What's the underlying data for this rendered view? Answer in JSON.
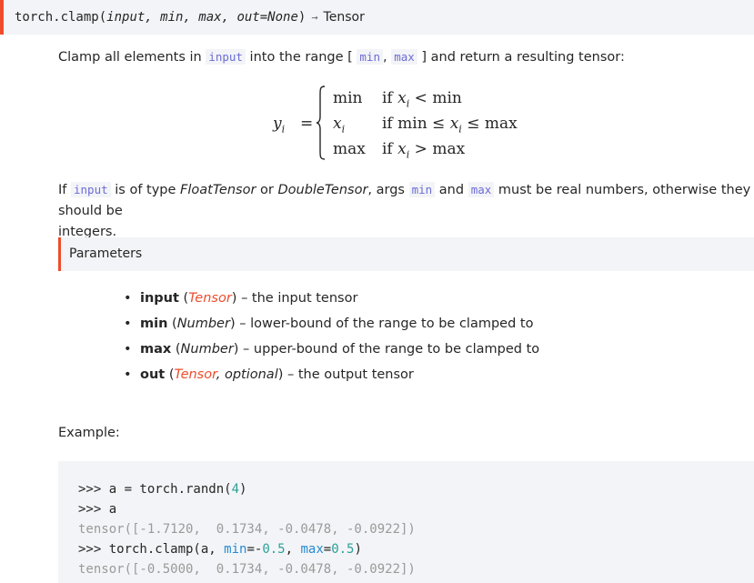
{
  "signature": {
    "func": "torch.clamp",
    "paren_open": "(",
    "args": "input, min, max, out=None",
    "paren_close": ")",
    "arrow": "→",
    "return_type": "Tensor"
  },
  "description": {
    "t1": "Clamp all elements in ",
    "c1": "input",
    "t2": " into the range [ ",
    "c2": "min",
    "t3": ", ",
    "c3": "max",
    "t4": " ] and return a resulting tensor:"
  },
  "formula": {
    "lhs": "y",
    "lhs_sub": "i",
    "eq": "=",
    "rows": [
      {
        "value": "min",
        "cond_pre": "if ",
        "cond_var": "x",
        "cond_sub": "i",
        "cond_op": " < ",
        "cond_post": "min"
      },
      {
        "value_var": "x",
        "value_sub": "i",
        "cond_pre": "if min ≤ ",
        "cond_var": "x",
        "cond_sub": "i",
        "cond_op": " ≤ ",
        "cond_post": "max"
      },
      {
        "value": "max",
        "cond_pre": "if ",
        "cond_var": "x",
        "cond_sub": "i",
        "cond_op": " > ",
        "cond_post": "max"
      }
    ]
  },
  "note": {
    "t1": "If ",
    "c1": "input",
    "t2": " is of type ",
    "i1": "FloatTensor",
    "t3": " or ",
    "i2": "DoubleTensor",
    "t4": ", args ",
    "c2": "min",
    "t5": " and ",
    "c3": "max",
    "t6": " must be real numbers, otherwise they should be",
    "line2": "integers."
  },
  "parameters": {
    "heading": "Parameters",
    "items": [
      {
        "bullet": "•",
        "name": "input",
        "open": " (",
        "type": "Tensor",
        "type2": "",
        "close": ")",
        "desc": " – the input tensor"
      },
      {
        "bullet": "•",
        "name": "min",
        "open": " (",
        "type": "Number",
        "type2": "",
        "close": ")",
        "desc": " – lower-bound of the range to be clamped to"
      },
      {
        "bullet": "•",
        "name": "max",
        "open": " (",
        "type": "Number",
        "type2": "",
        "close": ")",
        "desc": " – upper-bound of the range to be clamped to"
      },
      {
        "bullet": "•",
        "name": "out",
        "open": " (",
        "type": "Tensor",
        "type2": ", optional",
        "close": ")",
        "desc": " – the output tensor"
      }
    ]
  },
  "example": {
    "label": "Example:",
    "lines": {
      "l1_prompt": ">>> ",
      "l1_code": "a = torch.randn(",
      "l1_num": "4",
      "l1_end": ")",
      "l2_prompt": ">>> ",
      "l2_code": "a",
      "l3": "tensor([-1.7120,  0.1734, -0.0478, -0.0922])",
      "l4_prompt": ">>> ",
      "l4_code": "torch.clamp(a, ",
      "l4_kw1": "min",
      "l4_eq1": "=-",
      "l4_n1": "0.5",
      "l4_sep": ", ",
      "l4_kw2": "max",
      "l4_eq2": "=",
      "l4_n2": "0.5",
      "l4_end": ")",
      "l5": "tensor([-0.5000,  0.1734, -0.0478, -0.0922])"
    }
  }
}
